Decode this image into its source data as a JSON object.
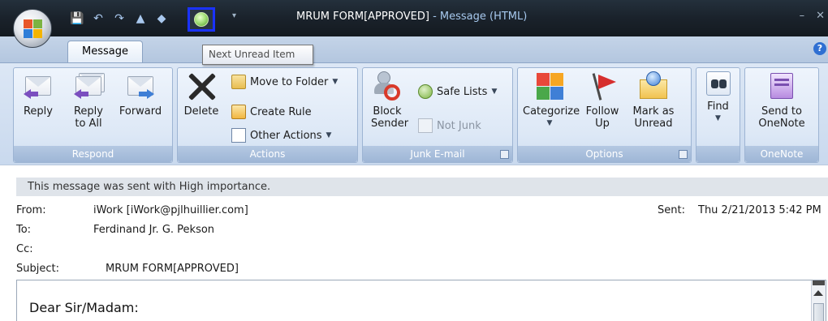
{
  "window": {
    "title": "MRUM FORM[APPROVED]",
    "title_suffix": " - Message (HTML)",
    "minimize": "–",
    "close": "✕"
  },
  "quick_access": {
    "save": "💾",
    "undo": "↶",
    "redo": "↷",
    "previous": "▲",
    "next": "◆",
    "more": "▾"
  },
  "tabs": [
    {
      "label": "Message",
      "active": true
    }
  ],
  "tooltip": {
    "text": "Next Unread Item"
  },
  "help": "?",
  "ribbon": {
    "groups": [
      {
        "label": "Respond",
        "buttons": [
          {
            "label": "Reply"
          },
          {
            "label": "Reply to All"
          },
          {
            "label": "Forward"
          }
        ]
      },
      {
        "label": "Actions",
        "delete": "Delete",
        "move_to_folder": "Move to Folder",
        "create_rule": "Create Rule",
        "other_actions": "Other Actions"
      },
      {
        "label": "Junk E-mail",
        "block_sender": "Block Sender",
        "safe_lists": "Safe Lists",
        "not_junk": "Not Junk"
      },
      {
        "label": "Options",
        "categorize": "Categorize",
        "follow_up": "Follow Up",
        "mark_unread": "Mark as Unread"
      },
      {
        "label": "",
        "find": "Find"
      },
      {
        "label": "OneNote",
        "send_to_onenote": "Send to OneNote"
      }
    ]
  },
  "message": {
    "importance_banner": "This message was sent with High importance.",
    "from_label": "From:",
    "from_value": "iWork [iWork@pjlhuillier.com]",
    "to_label": "To:",
    "to_value": "Ferdinand Jr. G. Pekson",
    "cc_label": "Cc:",
    "cc_value": "",
    "subject_label": "Subject:",
    "subject_value": "MRUM FORM[APPROVED]",
    "sent_label": "Sent:",
    "sent_value": "Thu 2/21/2013 5:42 PM",
    "body_greeting": "Dear Sir/Madam:"
  },
  "colors": {
    "highlight_border": "#1a32ff",
    "titlebar": "#1a222b",
    "ribbon": "#dce7f5"
  }
}
